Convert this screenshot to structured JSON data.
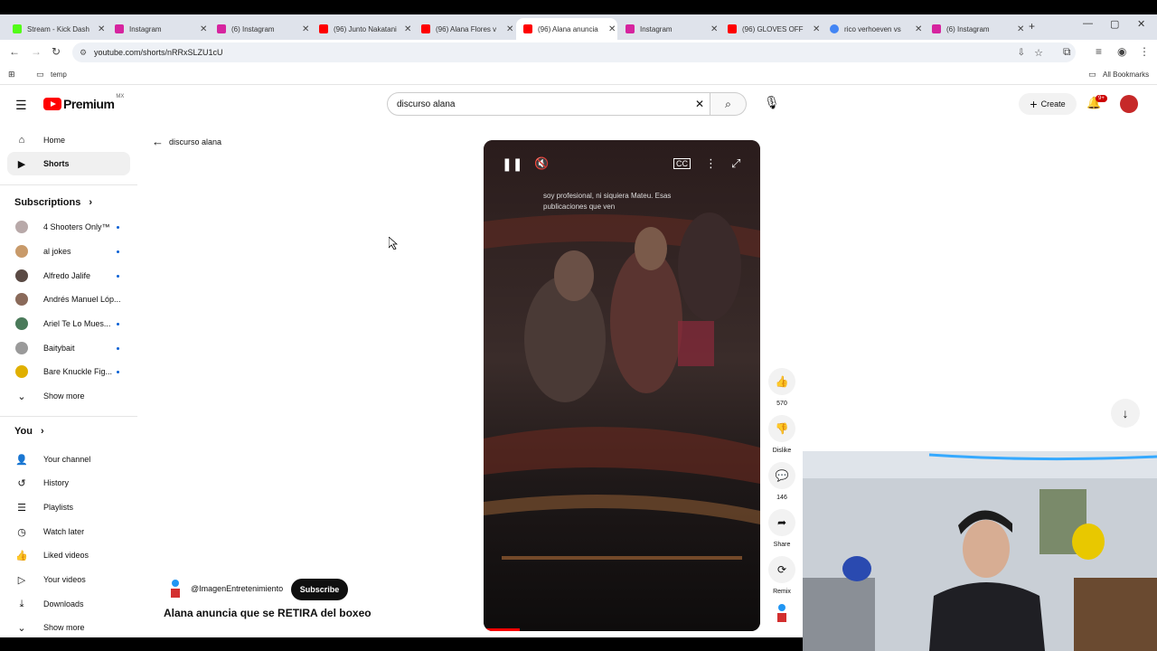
{
  "tabs": [
    {
      "title": "Stream - Kick Dash",
      "color": "#53fc18"
    },
    {
      "title": "Instagram",
      "color": "#d6249f"
    },
    {
      "title": "(6) Instagram",
      "color": "#d6249f"
    },
    {
      "title": "(96) Junto Nakatani",
      "color": "#ff0000"
    },
    {
      "title": "(96) Alana Flores v",
      "color": "#ff0000"
    },
    {
      "title": "(96) Alana anuncia",
      "color": "#ff0000",
      "active": true
    },
    {
      "title": "Instagram",
      "color": "#d6249f"
    },
    {
      "title": "(96) GLOVES OFF",
      "color": "#ff0000"
    },
    {
      "title": "rico verhoeven vs",
      "color": "#4285f4"
    },
    {
      "title": "(6) Instagram",
      "color": "#d6249f"
    }
  ],
  "address": {
    "url": "youtube.com/shorts/nRRxSLZU1cU"
  },
  "bookmarks": {
    "folder": "temp",
    "all": "All Bookmarks"
  },
  "header": {
    "logo": "Premium",
    "region": "MX",
    "search_value": "discurso alana",
    "create_label": "Create",
    "notif_count": "9+"
  },
  "sidebar": {
    "items": [
      {
        "label": "Home"
      },
      {
        "label": "Shorts"
      }
    ],
    "subscriptions_heading": "Subscriptions",
    "subscriptions": [
      {
        "name": "4 Shooters Only™"
      },
      {
        "name": "al jokes"
      },
      {
        "name": "Alfredo Jalife"
      },
      {
        "name": "Andrés Manuel Lóp..."
      },
      {
        "name": "Ariel Te Lo Mues..."
      },
      {
        "name": "Baitybait"
      },
      {
        "name": "Bare Knuckle Fig..."
      }
    ],
    "show_more": "Show more",
    "you_heading": "You",
    "you_items": [
      {
        "label": "Your channel"
      },
      {
        "label": "History"
      },
      {
        "label": "Playlists"
      },
      {
        "label": "Watch later"
      },
      {
        "label": "Liked videos"
      },
      {
        "label": "Your videos"
      },
      {
        "label": "Downloads"
      }
    ],
    "you_show_more": "Show more"
  },
  "back_query": "discurso alana",
  "short": {
    "caption": "soy profesional, ni siquiera Mateu. Esas publicaciones que ven",
    "channel": "@ImagenEntretenimiento",
    "subscribe": "Subscribe",
    "title": "Alana anuncia que se RETIRA del boxeo"
  },
  "actions": {
    "likes": "570",
    "dislike": "Dislike",
    "comments": "146",
    "share": "Share",
    "remix": "Remix"
  }
}
